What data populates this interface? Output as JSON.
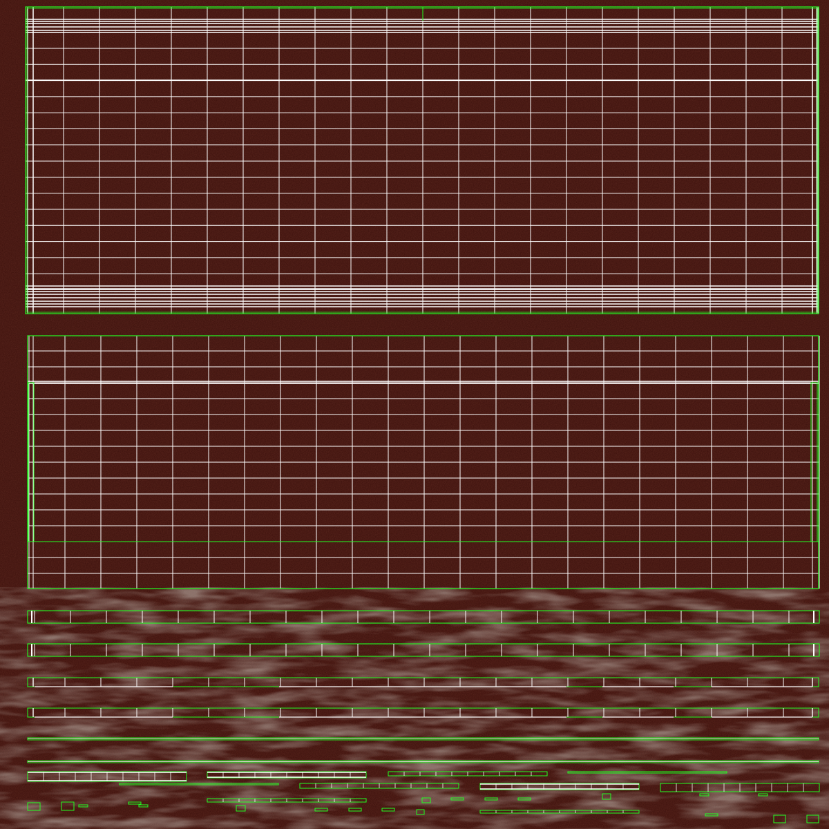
{
  "colors": {
    "texture_base": "#3a0f0b",
    "texture_dark": "#2a0906",
    "texture_light": "#4a1a14",
    "uv_edge": "#ffffff",
    "uv_seam": "#22ff22"
  },
  "texture": {
    "description_icon": "rust-metal-texture",
    "lower_weathering": true
  },
  "uv_layout": {
    "island_count_visible": 40,
    "grid_color": "#ffffff",
    "border_color": "#22ff22"
  }
}
